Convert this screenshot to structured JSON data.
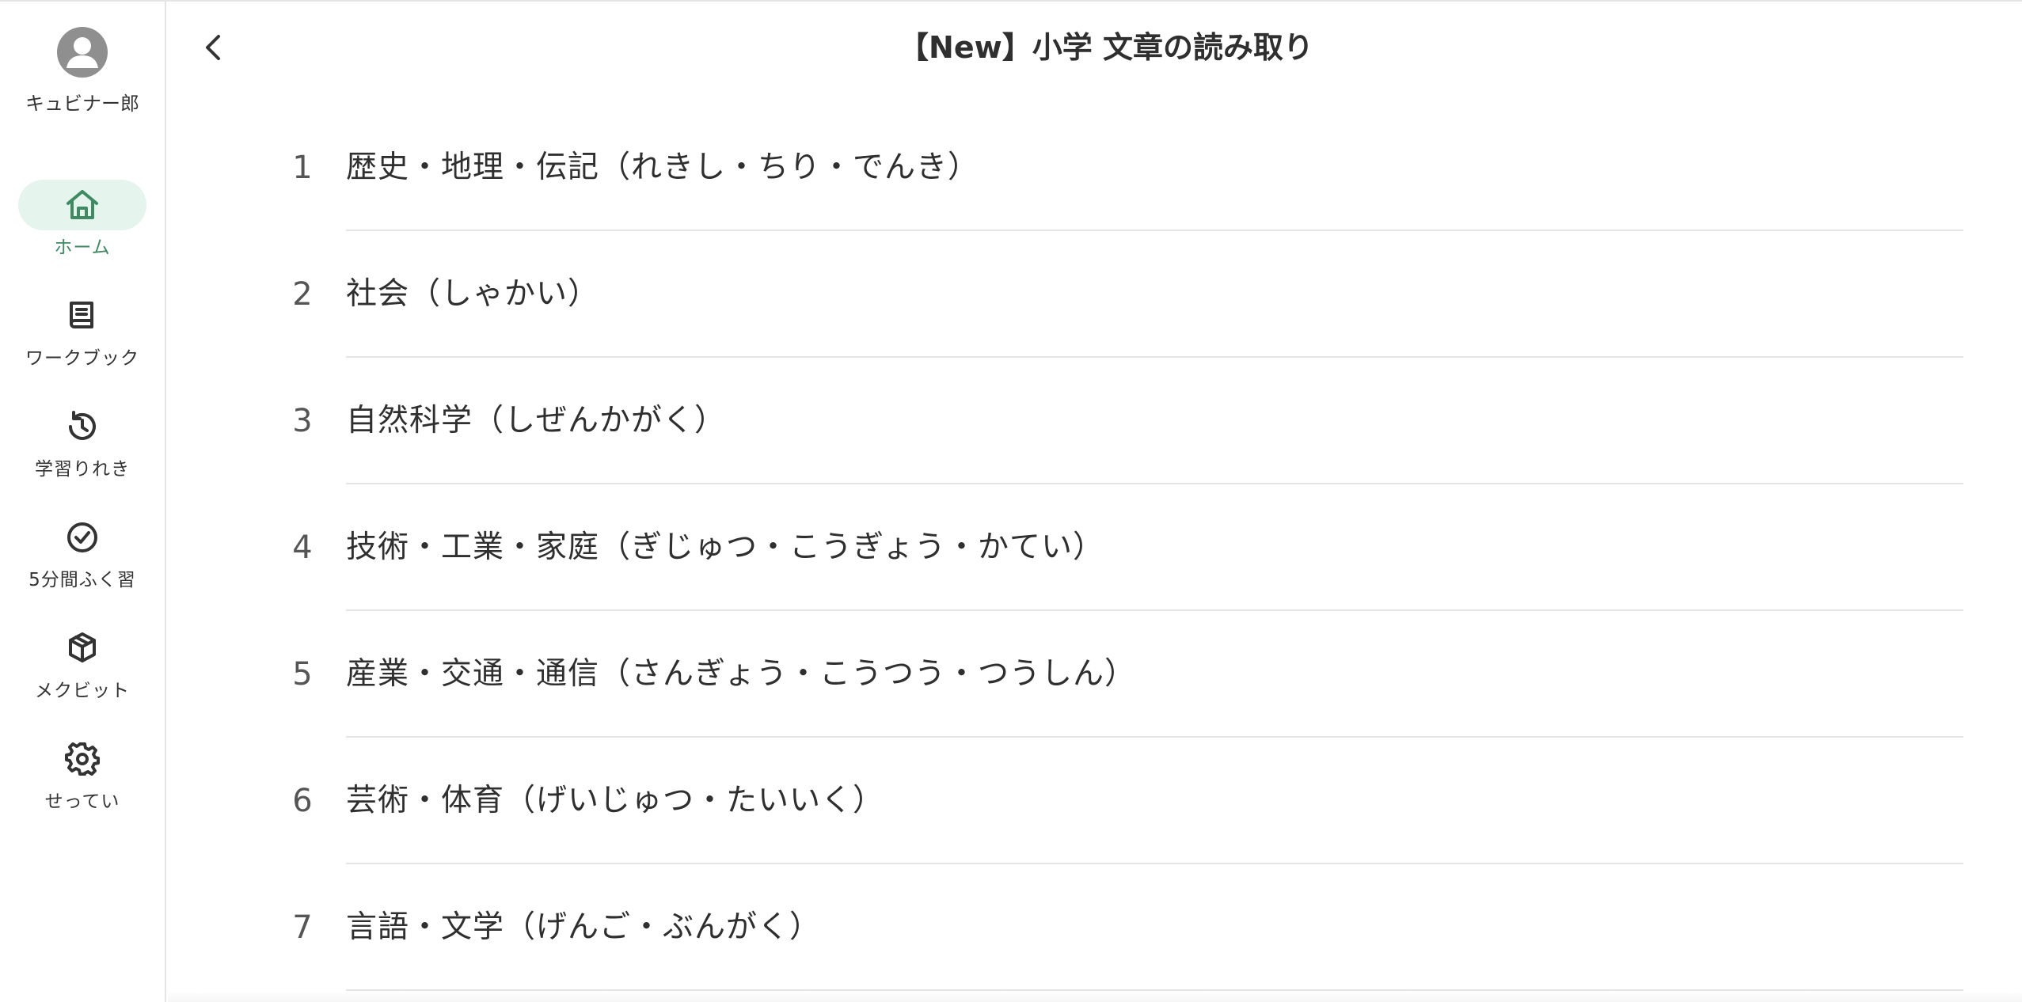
{
  "header": {
    "title": "【New】小学 文章の読み取り",
    "back_icon": "chevron-left-icon"
  },
  "profile": {
    "name": "キュビナー郎",
    "avatar_icon": "user-avatar-icon"
  },
  "sidebar": {
    "active_color": "#3f8a63",
    "active_bg": "#e5f4ec",
    "items": [
      {
        "label": "ホーム",
        "icon": "home-icon",
        "active": true
      },
      {
        "label": "ワークブック",
        "icon": "book-icon",
        "active": false
      },
      {
        "label": "学習りれき",
        "icon": "history-icon",
        "active": false
      },
      {
        "label": "5分間ふく習",
        "icon": "check-circle-icon",
        "active": false
      },
      {
        "label": "メクビット",
        "icon": "cube-icon",
        "active": false
      },
      {
        "label": "せってい",
        "icon": "gear-icon",
        "active": false
      }
    ]
  },
  "list": {
    "items": [
      {
        "number": "1",
        "label": "歴史・地理・伝記（れきし・ちり・でんき）"
      },
      {
        "number": "2",
        "label": "社会（しゃかい）"
      },
      {
        "number": "3",
        "label": "自然科学（しぜんかがく）"
      },
      {
        "number": "4",
        "label": "技術・工業・家庭（ぎじゅつ・こうぎょう・かてい）"
      },
      {
        "number": "5",
        "label": "産業・交通・通信（さんぎょう・こうつう・つうしん）"
      },
      {
        "number": "6",
        "label": "芸術・体育（げいじゅつ・たいいく）"
      },
      {
        "number": "7",
        "label": "言語・文学（げんご・ぶんがく）"
      }
    ]
  }
}
